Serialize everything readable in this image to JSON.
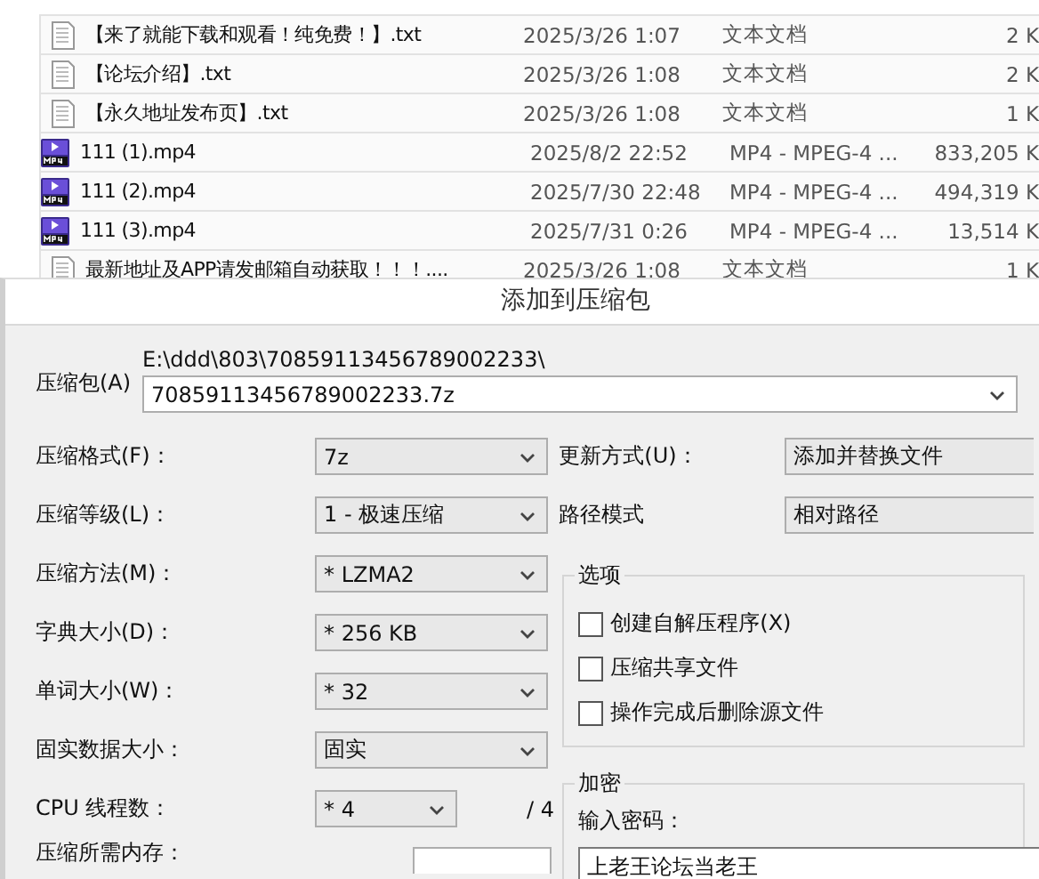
{
  "file_list": {
    "rows": [
      {
        "kind": "text",
        "name": "【来了就能下载和观看！纯免费！】.txt",
        "date": "2025/3/26 1:07",
        "type": "文本文档",
        "size": "2 K"
      },
      {
        "kind": "text",
        "name": "【论坛介绍】.txt",
        "date": "2025/3/26 1:08",
        "type": "文本文档",
        "size": "2 K"
      },
      {
        "kind": "text",
        "name": "【永久地址发布页】.txt",
        "date": "2025/3/26 1:08",
        "type": "文本文档",
        "size": "1 K"
      },
      {
        "kind": "video",
        "name": "111 (1).mp4",
        "date": "2025/8/2 22:52",
        "type": "MP4 - MPEG-4 ...",
        "size": "833,205 K"
      },
      {
        "kind": "video",
        "name": "111 (2).mp4",
        "date": "2025/7/30 22:48",
        "type": "MP4 - MPEG-4 ...",
        "size": "494,319 K"
      },
      {
        "kind": "video",
        "name": "111 (3).mp4",
        "date": "2025/7/31 0:26",
        "type": "MP4 - MPEG-4 ...",
        "size": "13,514 K"
      },
      {
        "kind": "text",
        "name": "最新地址及APP请发邮箱自动获取！！！....",
        "date": "2025/3/26 1:08",
        "type": "文本文档",
        "size": "1 K"
      }
    ]
  },
  "dialog": {
    "title": "添加到压缩包",
    "archive": {
      "label": "压缩包(A)",
      "path": "E:\\ddd\\803\\70859113456789002233\\",
      "value": "70859113456789002233.7z"
    },
    "left_settings": [
      {
        "kind": "combo",
        "label": "压缩格式(F)：",
        "value": "7z"
      },
      {
        "kind": "combo",
        "label": "压缩等级(L)：",
        "value": "1 - 极速压缩"
      },
      {
        "kind": "combo",
        "label": "压缩方法(M)：",
        "value": "* LZMA2"
      },
      {
        "kind": "combo",
        "label": "字典大小(D)：",
        "value": "* 256 KB"
      },
      {
        "kind": "combo",
        "label": "单词大小(W)：",
        "value": "* 32"
      },
      {
        "kind": "combo",
        "label": "固实数据大小：",
        "value": "固实"
      },
      {
        "kind": "threads",
        "label": "CPU 线程数：",
        "value": "* 4",
        "suffix": "/ 4"
      },
      {
        "kind": "readout",
        "label": "压缩所需内存："
      }
    ],
    "right_settings": [
      {
        "label": "更新方式(U)：",
        "value": "添加并替换文件"
      },
      {
        "label": "路径模式",
        "value": "相对路径"
      }
    ],
    "options": {
      "title": "选项",
      "items": [
        {
          "label": "创建自解压程序(X)",
          "checked": false
        },
        {
          "label": "压缩共享文件",
          "checked": false
        },
        {
          "label": "操作完成后删除源文件",
          "checked": false
        }
      ]
    },
    "encryption": {
      "title": "加密",
      "password_label": "输入密码：",
      "password": "上老王论坛当老王"
    }
  }
}
